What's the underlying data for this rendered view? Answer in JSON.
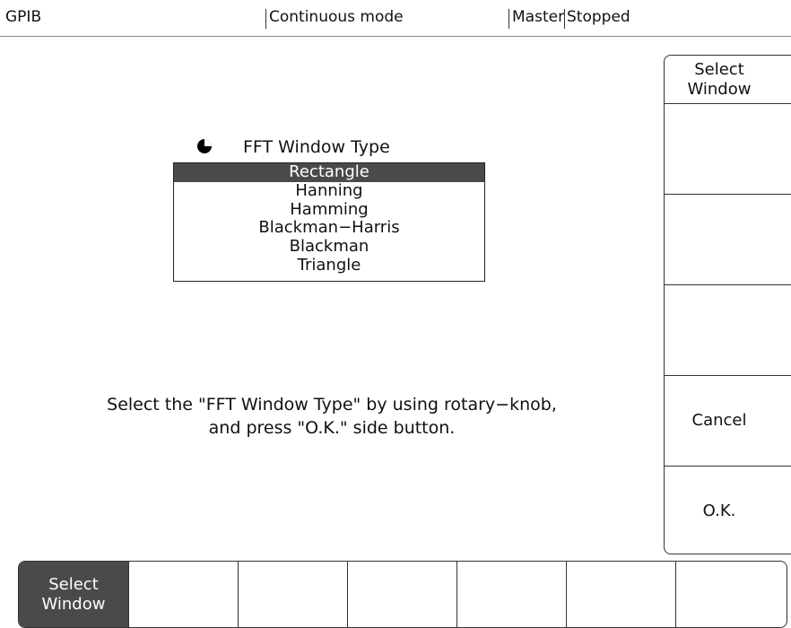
{
  "status": {
    "interface": "GPIB",
    "mode": "Continuous mode",
    "role": "Master",
    "state": "Stopped"
  },
  "side_menu": {
    "items": [
      {
        "label": "Select\nWindow"
      },
      {
        "label": ""
      },
      {
        "label": ""
      },
      {
        "label": ""
      },
      {
        "label": "Cancel"
      },
      {
        "label": "O.K."
      }
    ]
  },
  "dialog": {
    "title": "FFT Window Type",
    "options": [
      "Rectangle",
      "Hanning",
      "Hamming",
      "Blackman−Harris",
      "Blackman",
      "Triangle"
    ],
    "selected": "Rectangle",
    "instruction": "Select the \"FFT Window Type\" by using rotary−knob,\nand press \"O.K.\" side button."
  },
  "bottom_menu": {
    "tabs": [
      {
        "label": "Select\nWindow",
        "active": true
      },
      {
        "label": ""
      },
      {
        "label": ""
      },
      {
        "label": ""
      },
      {
        "label": ""
      },
      {
        "label": ""
      },
      {
        "label": ""
      }
    ]
  }
}
